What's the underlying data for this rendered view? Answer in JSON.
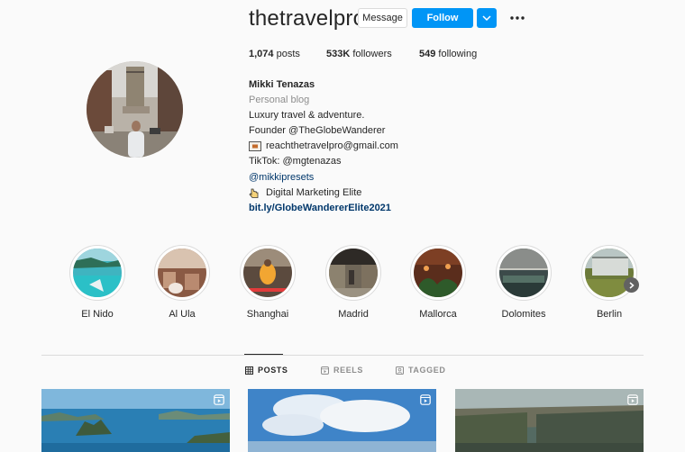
{
  "profile": {
    "username": "thetravelpro",
    "message_label": "Message",
    "follow_label": "Follow"
  },
  "stats": {
    "posts_count": "1,074",
    "posts_label": "posts",
    "followers_count": "533K",
    "followers_label": "followers",
    "following_count": "549",
    "following_label": "following"
  },
  "bio": {
    "name": "Mikki Tenazas",
    "category": "Personal blog",
    "line1": "Luxury travel & adventure.",
    "line2": "Founder @TheGlobeWanderer",
    "email": "reachthetravelpro@gmail.com",
    "tiktok": "TikTok: @mgtenazas",
    "presets": "@mikkipresets",
    "marketing": "Digital Marketing Elite",
    "link": "bit.ly/GlobeWandererElite2021"
  },
  "highlights": [
    {
      "label": "El Nido"
    },
    {
      "label": "Al Ula"
    },
    {
      "label": "Shanghai"
    },
    {
      "label": "Madrid"
    },
    {
      "label": "Mallorca"
    },
    {
      "label": "Dolomites"
    },
    {
      "label": "Berlin"
    }
  ],
  "tabs": [
    {
      "label": "POSTS",
      "icon": "grid-icon",
      "active": true
    },
    {
      "label": "REELS",
      "icon": "reels-icon",
      "active": false
    },
    {
      "label": "TAGGED",
      "icon": "tagged-icon",
      "active": false
    }
  ],
  "colors": {
    "accent": "#0095f6",
    "link": "#00376b",
    "muted": "#8e8e8e",
    "text": "#262626",
    "background": "#fafafa"
  }
}
